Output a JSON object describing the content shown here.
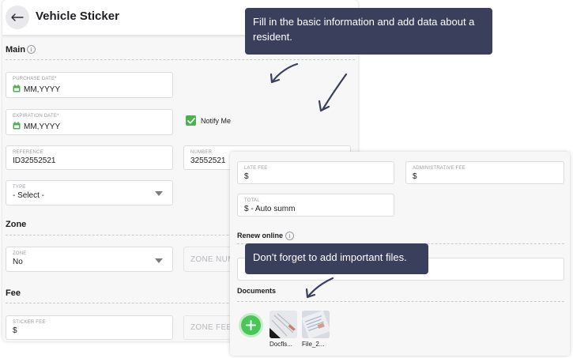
{
  "header": {
    "title": "Vehicle Sticker"
  },
  "main_section": {
    "title": "Main",
    "purchase_date": {
      "label": "PURCHASE DATE*",
      "value": "MM,YYYY"
    },
    "expiration_date": {
      "label": "EXPIRATION DATE*",
      "value": "MM,YYYY"
    },
    "notify": {
      "label": "Notify Me",
      "checked": true
    },
    "reference": {
      "label": "REFERENCE",
      "value": "ID32552521"
    },
    "number": {
      "label": "NUMBER",
      "value": "32552521"
    },
    "type": {
      "label": "TYPE",
      "value": "- Select -"
    }
  },
  "zone_section": {
    "title": "Zone",
    "zone": {
      "label": "ZONE",
      "value": "No"
    },
    "zone_number": {
      "placeholder": "ZONE NUMBER"
    }
  },
  "fee_section": {
    "title": "Fee",
    "sticker_fee": {
      "label": "STICKER FEE",
      "value": "$"
    },
    "zone_fee": {
      "placeholder": "ZONE FEE"
    }
  },
  "right_panel": {
    "late_fee": {
      "label": "LATE FEE",
      "value": "$"
    },
    "administrative_fee": {
      "label": "ADMINISTRATIVE FEE",
      "value": "$"
    },
    "total": {
      "label": "TOTAL",
      "value": "$ - Auto summ"
    },
    "renew_online": {
      "title": "Renew online"
    },
    "documents": {
      "title": "Documents",
      "files": [
        {
          "name": "Docfls...",
          "icon": "document-thumbnail-icon"
        },
        {
          "name": "File_2...",
          "icon": "document-thumbnail-icon"
        }
      ]
    }
  },
  "tooltips": {
    "top": "Fill in the basic information and add data about a resident.",
    "bottom": "Don't forget to add important files."
  },
  "colors": {
    "accent_green": "#4caf50",
    "tooltip_bg": "#3a3f5c",
    "panel_bg": "#f7f7f8"
  }
}
